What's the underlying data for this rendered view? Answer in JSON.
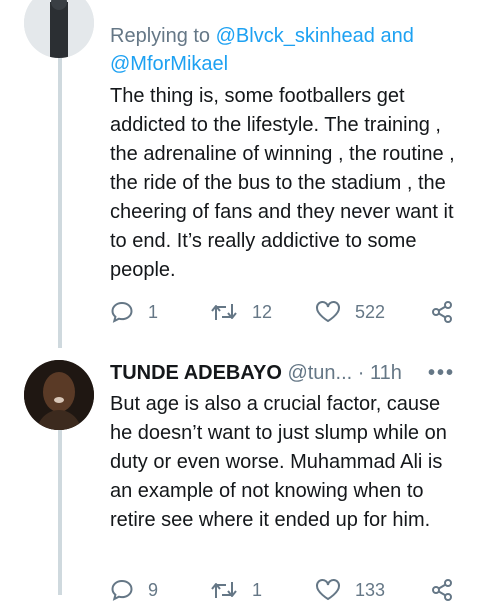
{
  "tweet1": {
    "replying_label": "Replying to",
    "mention1": "@Blvck_skinhead",
    "and_label": "and",
    "mention2": "@MforMikael",
    "text": "The thing is, some footballers get addicted to the lifestyle. The training , the adrenaline of winning , the routine , the ride of the bus to the stadium , the cheering of fans and they never want it to end. It’s really addictive to some people.",
    "actions": {
      "replies": "1",
      "retweets": "12",
      "likes": "522"
    }
  },
  "tweet2": {
    "author": "TUNDE ADEBAYO",
    "handle": "@tun...",
    "separator": "·",
    "time": "11h",
    "more": "•••",
    "text": "But age is also a crucial factor, cause he doesn’t want to just slump while on duty or even worse. Muhammad Ali is an example of not knowing when to retire see where it ended up for him.",
    "actions": {
      "replies": "9",
      "retweets": "1",
      "likes": "133"
    }
  },
  "colors": {
    "text": "#14171a",
    "muted": "#657786",
    "link": "#1da1f2",
    "thread_line": "#cfd9de"
  },
  "icons": [
    "reply-icon",
    "retweet-icon",
    "like-icon",
    "share-icon",
    "more-icon"
  ]
}
